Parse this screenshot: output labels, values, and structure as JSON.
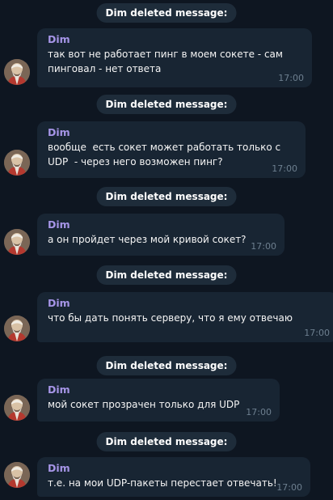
{
  "service_label": "Dim deleted message:",
  "messages": [
    {
      "sender": "Dim",
      "text": "так вот не работает пинг в моем сокете - сам пинговал - нет ответа",
      "time": "17:00"
    },
    {
      "sender": "Dim",
      "text": "вообще  есть сокет может работать только с UDP  - через него возможен пинг?",
      "time": "17:00"
    },
    {
      "sender": "Dim",
      "text": "а он пройдет через мой кривой сокет?",
      "time": "17:00"
    },
    {
      "sender": "Dim",
      "text": "что бы дать понять серверу, что я ему отвечаю",
      "time": "17:00"
    },
    {
      "sender": "Dim",
      "text": "мой сокет прозрачен только для UDP",
      "time": "17:00"
    },
    {
      "sender": "Dim",
      "text": "т.е. на мои UDP-пакеты перестает отвечать!",
      "time": "17:00"
    }
  ],
  "colors": {
    "background": "#0e1621",
    "bubble": "#182533",
    "sender": "#a695e7",
    "time": "#6d7f8f",
    "service_pill": "#1e2c3a"
  },
  "icons": {
    "avatar": "avatar-portrait"
  }
}
